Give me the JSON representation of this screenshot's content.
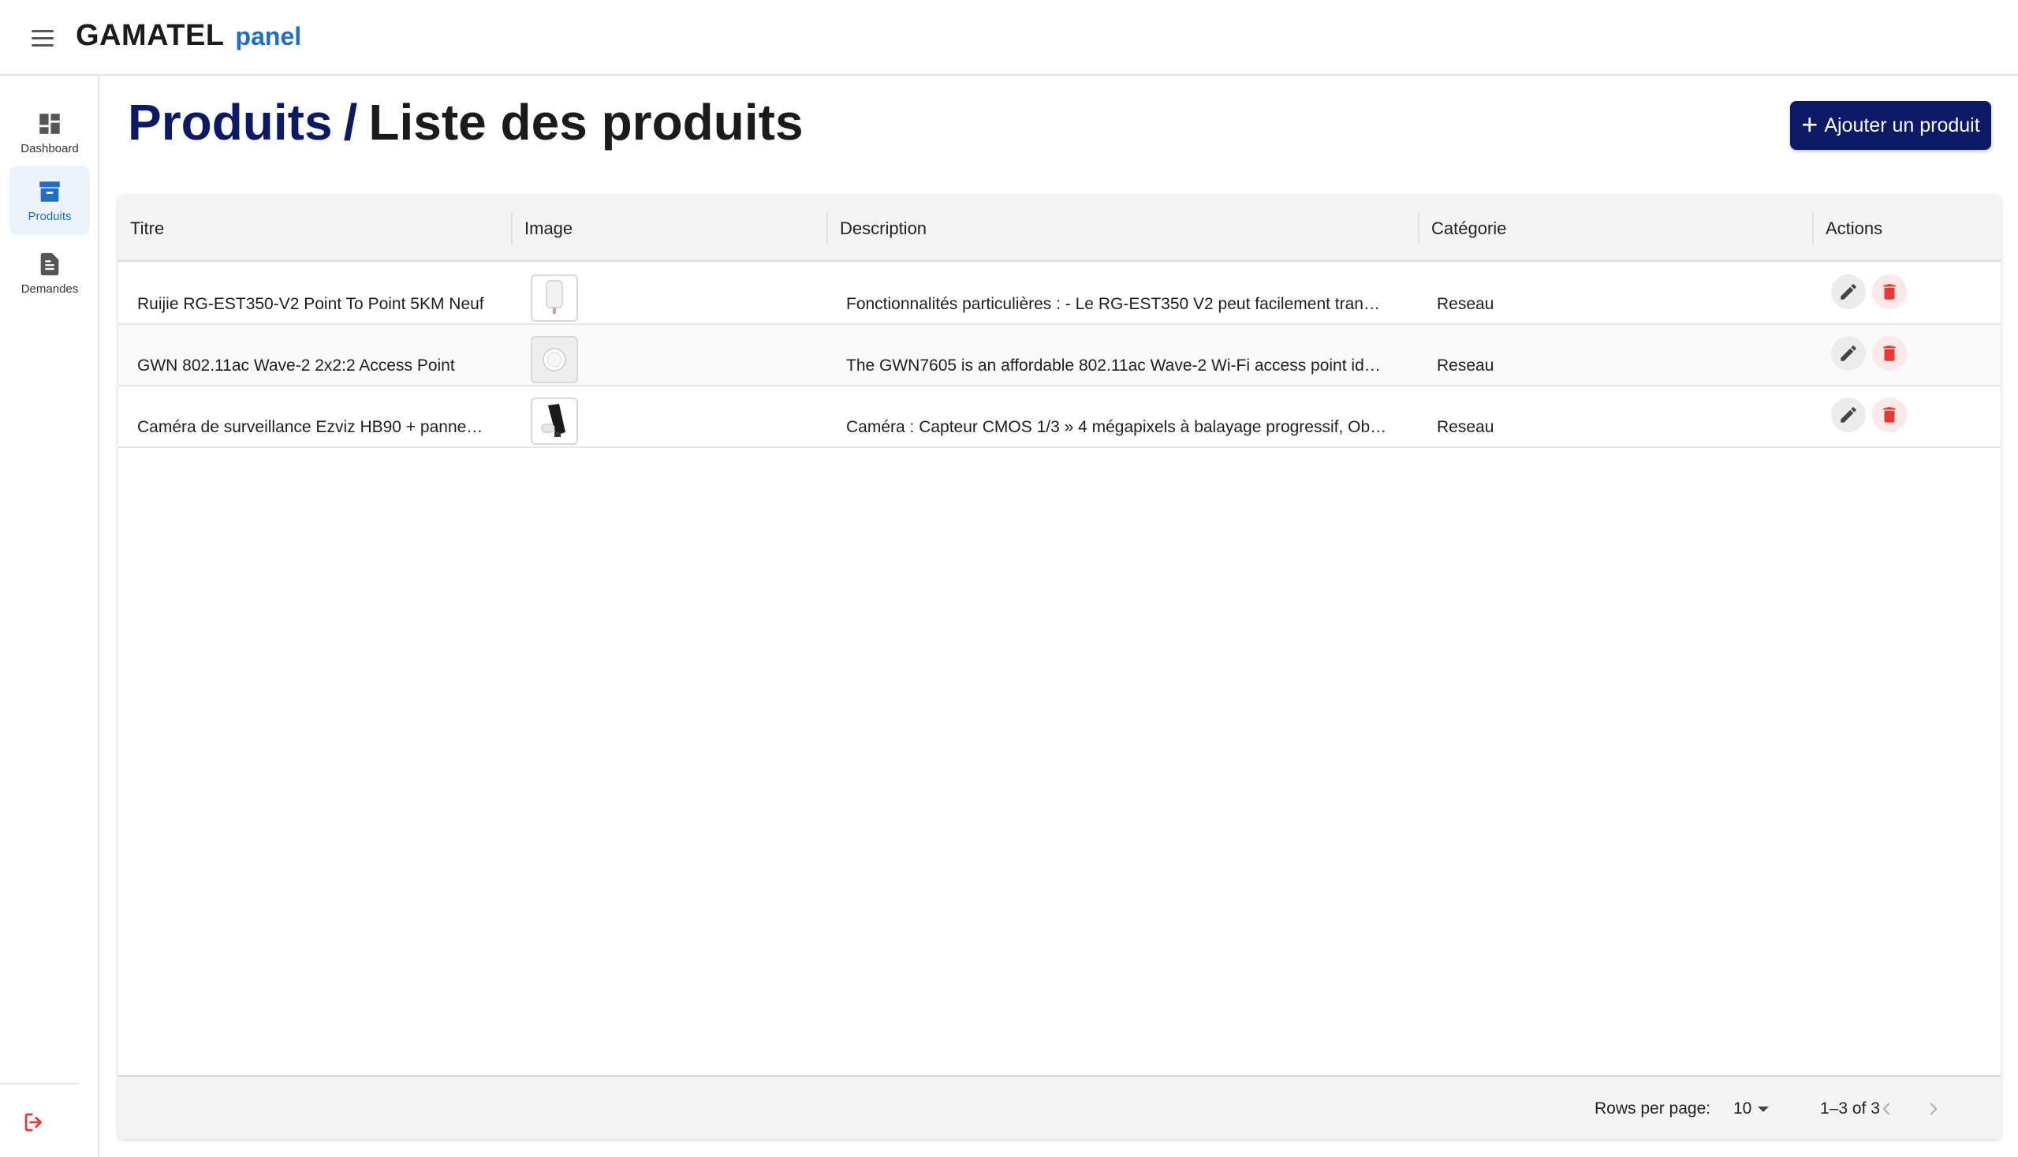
{
  "header": {
    "brand_main": "GAMATEL",
    "brand_sub": "panel"
  },
  "sidebar": {
    "items": [
      {
        "label": "Dashboard",
        "icon": "dashboard-icon",
        "active": false
      },
      {
        "label": "Produits",
        "icon": "archive-box-icon",
        "active": true
      },
      {
        "label": "Demandes",
        "icon": "document-icon",
        "active": false
      }
    ],
    "logout_icon": "logout-icon"
  },
  "page": {
    "crumb": "Produits",
    "separator": "/",
    "current": "Liste des produits",
    "add_button_label": "Ajouter un produit"
  },
  "table": {
    "columns": [
      "Titre",
      "Image",
      "Description",
      "Catégorie",
      "Actions"
    ],
    "rows": [
      {
        "title": "Ruijie RG-EST350-V2 Point To Point 5KM Neuf",
        "description": "Fonctionnalités particulières : - Le RG-EST350 V2 peut facilement tran…",
        "category": "Reseau"
      },
      {
        "title": "GWN 802.11ac Wave-2 2x2:2 Access Point",
        "description": "The GWN7605 is an affordable 802.11ac Wave-2 Wi-Fi access point id…",
        "category": "Reseau"
      },
      {
        "title": "Caméra de surveillance Ezviz HB90 + panne…",
        "description": "Caméra : Capteur CMOS 1/3 » 4 mégapixels à balayage progressif, Ob…",
        "category": "Reseau"
      }
    ]
  },
  "pagination": {
    "rows_per_page_label": "Rows per page:",
    "rows_per_page_value": "10",
    "range": "1–3 of 3"
  },
  "colors": {
    "primary": "#0c1a66",
    "accent": "#1e6fc2",
    "danger": "#e53935"
  }
}
